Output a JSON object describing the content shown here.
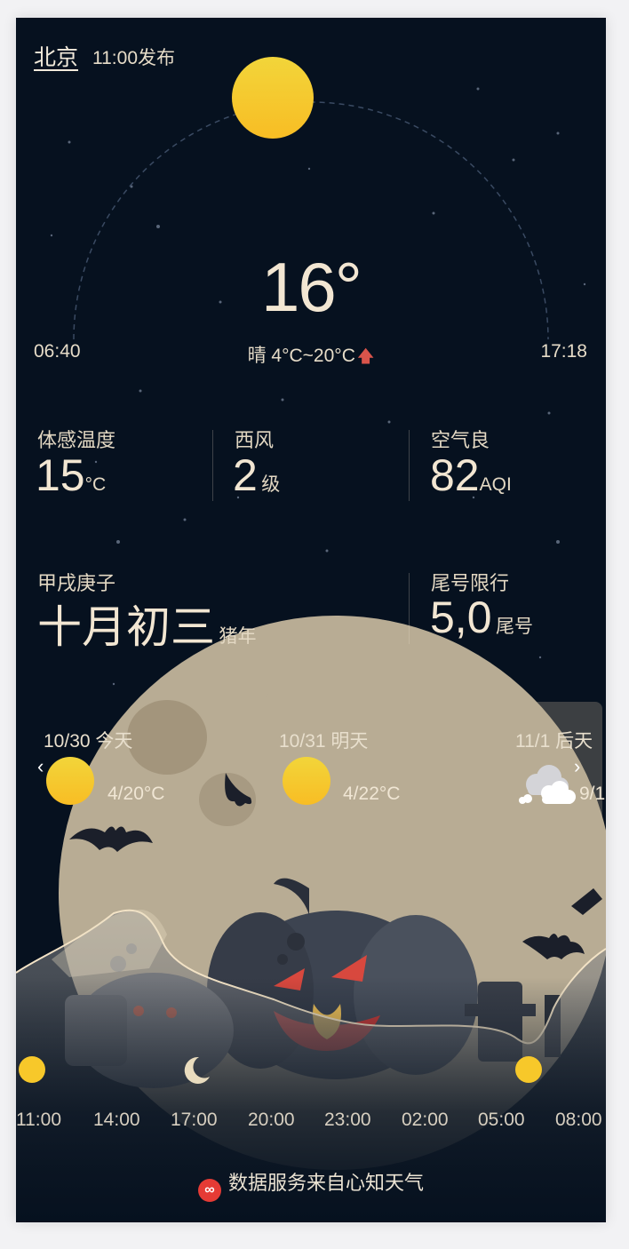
{
  "header": {
    "city": "北京",
    "publish_time": "11:00发布"
  },
  "current": {
    "temperature": "16°",
    "sunrise": "06:40",
    "sunset": "17:18",
    "condition_range": "晴 4°C~20°C",
    "trend_icon": "arrow-up-icon"
  },
  "stats": {
    "feels_like": {
      "label": "体感温度",
      "value": "15",
      "unit": "°C"
    },
    "wind": {
      "label": "西风",
      "value": "2",
      "unit": "级"
    },
    "air": {
      "label": "空气良",
      "value": "82",
      "unit": "AQI"
    }
  },
  "lunar": {
    "ganzhi": "甲戌庚子",
    "date": "十月初三",
    "year": "猪年"
  },
  "restriction": {
    "label": "尾号限行",
    "value": "5,0",
    "unit": "尾号"
  },
  "forecast": [
    {
      "date": "10/30 今天",
      "temp": "4/20°C",
      "icon": "sun-icon"
    },
    {
      "date": "10/31 明天",
      "temp": "4/22°C",
      "icon": "sun-icon"
    },
    {
      "date": "11/1 后天",
      "temp": "9/1",
      "icon": "cloud-icon"
    }
  ],
  "hourly": {
    "times": [
      "11:00",
      "14:00",
      "17:00",
      "20:00",
      "23:00",
      "02:00",
      "05:00",
      "08:00"
    ],
    "icons": [
      "sun-icon",
      "moon-icon",
      "sun-icon"
    ]
  },
  "footer": {
    "source": "数据服务来自心知天气"
  },
  "colors": {
    "background": "#06111f",
    "sun": "#f7c82a",
    "text": "#e9dfcc",
    "accent_red": "#d9544b"
  }
}
